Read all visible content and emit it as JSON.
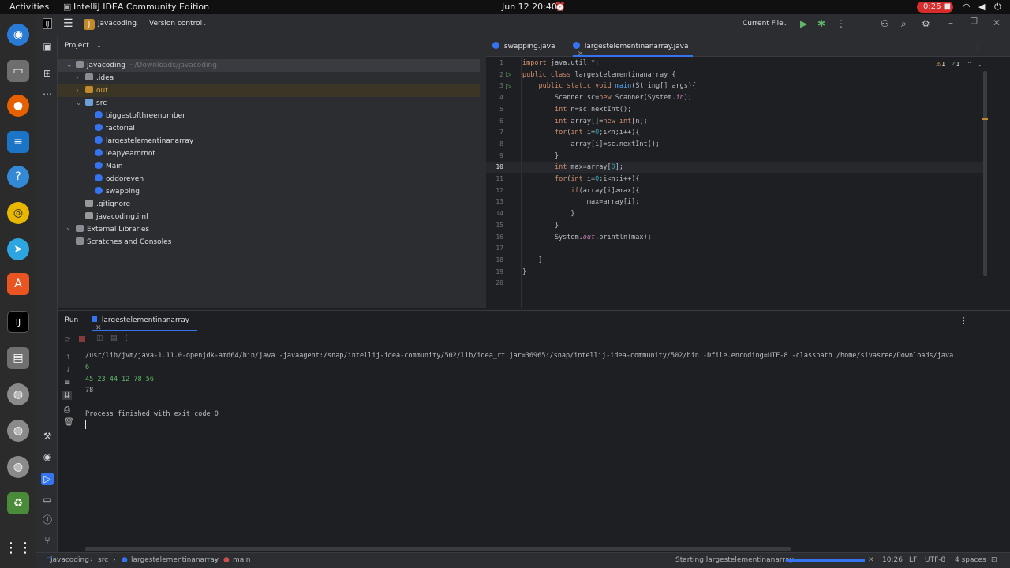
{
  "system": {
    "activities": "Activities",
    "app_name": "IntelliJ IDEA Community Edition",
    "datetime": "Jun 12  20:40",
    "recording_time": "0:26"
  },
  "titlebar": {
    "project_badge": "J",
    "project_name": "javacoding",
    "vcs": "Version control",
    "run_config": "Current File"
  },
  "project": {
    "header": "Project",
    "root_name": "javacoding",
    "root_path": "~/Downloads/javacoding",
    "items": [
      {
        "label": "javacoding",
        "indent": 0
      },
      {
        "label": ".idea",
        "indent": 1
      },
      {
        "label": "out",
        "indent": 1
      },
      {
        "label": "src",
        "indent": 1
      },
      {
        "label": "biggestofthreenumber",
        "indent": 2
      },
      {
        "label": "factorial",
        "indent": 2
      },
      {
        "label": "largestelementinanarray",
        "indent": 2
      },
      {
        "label": "leapyearornot",
        "indent": 2
      },
      {
        "label": "Main",
        "indent": 2
      },
      {
        "label": "oddoreven",
        "indent": 2
      },
      {
        "label": "swapping",
        "indent": 2
      },
      {
        "label": ".gitignore",
        "indent": 1
      },
      {
        "label": "javacoding.iml",
        "indent": 1
      },
      {
        "label": "External Libraries",
        "indent": 0
      },
      {
        "label": "Scratches and Consoles",
        "indent": 0
      }
    ]
  },
  "editor": {
    "tabs": [
      {
        "label": "swapping.java",
        "active": false
      },
      {
        "label": "largestelementinanarray.java",
        "active": true
      }
    ],
    "inspection_warnings": "1",
    "inspection_ok": "1",
    "lines": [
      "import java.util.*;",
      "public class largestelementinanarray {",
      "    public static void main(String[] args){",
      "        Scanner sc=new Scanner(System.in);",
      "        int n=sc.nextInt();",
      "        int array[]=new int[n];",
      "        for(int i=0;i<n;i++){",
      "            array[i]=sc.nextInt();",
      "        }",
      "        int max=array[0];",
      "        for(int i=0;i<n;i++){",
      "            if(array[i]>max){",
      "                max=array[i];",
      "            }",
      "        }",
      "        System.out.println(max);",
      "",
      "    }",
      "}",
      ""
    ],
    "line_numbers": [
      "1",
      "2",
      "3",
      "4",
      "5",
      "6",
      "7",
      "8",
      "9",
      "10",
      "11",
      "12",
      "13",
      "14",
      "15",
      "16",
      "17",
      "18",
      "19",
      "20"
    ]
  },
  "run": {
    "header": "Run",
    "tab_label": "largestelementinanarray",
    "command": "/usr/lib/jvm/java-1.11.0-openjdk-amd64/bin/java -javaagent:/snap/intellij-idea-community/502/lib/idea_rt.jar=36965:/snap/intellij-idea-community/502/bin -Dfile.encoding=UTF-8 -classpath /home/sivasree/Downloads/java",
    "input_count": "6",
    "input_values": "45 23 44 12 78 56",
    "result": "78",
    "exit_message": "Process finished with exit code 0"
  },
  "status": {
    "breadcrumb": [
      "javacoding",
      "src",
      "largestelementinanarray",
      "main"
    ],
    "task": "Starting largestelementinanarray",
    "position": "10:26",
    "line_sep": "LF",
    "encoding": "UTF-8",
    "indent": "4 spaces"
  },
  "colors": {
    "accent": "#3574f0",
    "bg_editor": "#1e1f22",
    "bg_panel": "#2b2d30",
    "run_green": "#5fb865",
    "recording_red": "#d62c2c"
  }
}
